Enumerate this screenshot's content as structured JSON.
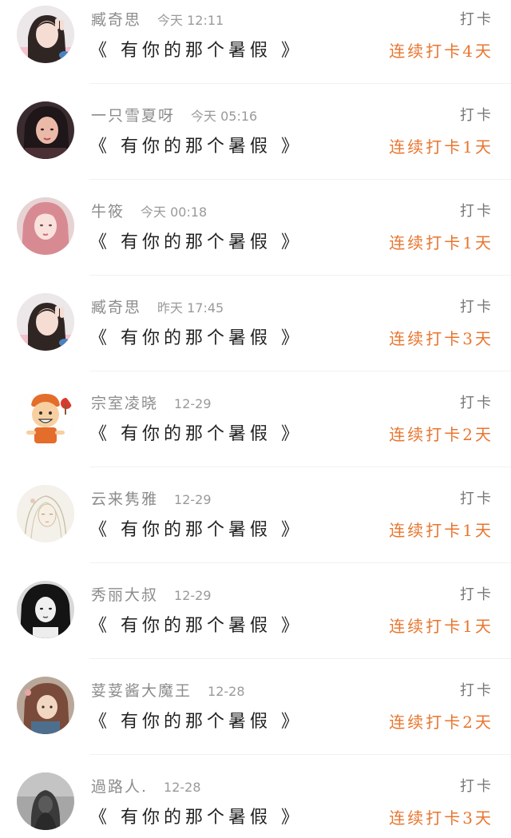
{
  "entries": [
    {
      "name": "臧奇思",
      "time": "今天 12:11",
      "title": "《 有你的那个暑假 》",
      "action": "打卡",
      "streak": "连续打卡4天",
      "avatar": "girl-peace-sign-avatar"
    },
    {
      "name": "一只雪夏呀",
      "time": "今天 05:16",
      "title": "《 有你的那个暑假 》",
      "action": "打卡",
      "streak": "连续打卡1天",
      "avatar": "girl-dark-hair-avatar"
    },
    {
      "name": "牛筱",
      "time": "今天 00:18",
      "title": "《 有你的那个暑假 》",
      "action": "打卡",
      "streak": "连续打卡1天",
      "avatar": "girl-pink-hair-avatar"
    },
    {
      "name": "臧奇思",
      "time": "昨天 17:45",
      "title": "《 有你的那个暑假 》",
      "action": "打卡",
      "streak": "连续打卡3天",
      "avatar": "girl-peace-sign-avatar"
    },
    {
      "name": "宗室凌晓",
      "time": "12-29",
      "title": "《 有你的那个暑假 》",
      "action": "打卡",
      "streak": "连续打卡2天",
      "avatar": "cartoon-boy-avatar"
    },
    {
      "name": "云来隽雅",
      "time": "12-29",
      "title": "《 有你的那个暑假 》",
      "action": "打卡",
      "streak": "连续打卡1天",
      "avatar": "sketch-girl-avatar"
    },
    {
      "name": "秀丽大叔",
      "time": "12-29",
      "title": "《 有你的那个暑假 》",
      "action": "打卡",
      "streak": "连续打卡1天",
      "avatar": "bw-girl-avatar"
    },
    {
      "name": "荽荽酱大魔王",
      "time": "12-28",
      "title": "《 有你的那个暑假 》",
      "action": "打卡",
      "streak": "连续打卡2天",
      "avatar": "illustrated-girl-avatar"
    },
    {
      "name": "過路人.",
      "time": "12-28",
      "title": "《 有你的那个暑假 》",
      "action": "打卡",
      "streak": "连续打卡3天",
      "avatar": "hooded-figure-avatar"
    }
  ],
  "colors": {
    "accent": "#e8752e",
    "name_text": "#8c8c8c",
    "title_text": "#222222",
    "action_text": "#777777",
    "divider": "#f1f1f1"
  }
}
